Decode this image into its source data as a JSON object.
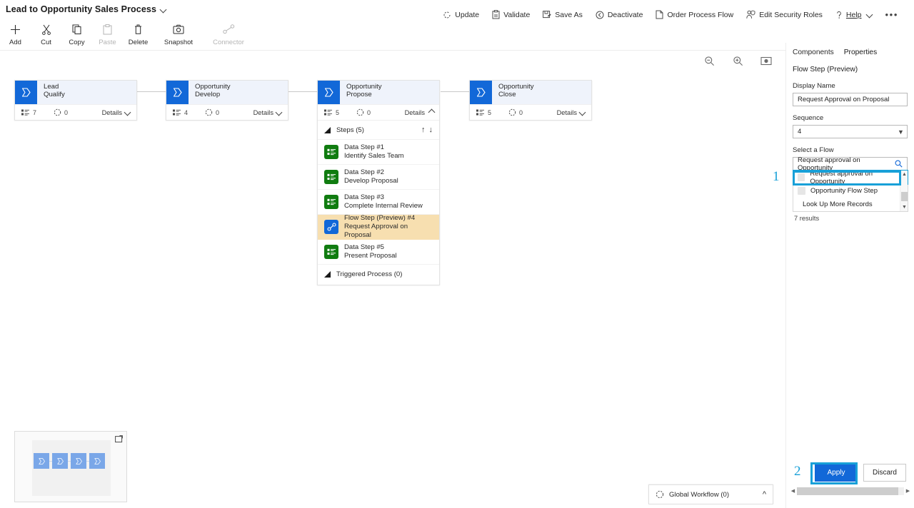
{
  "window": {
    "doc_title": "Lead to Opportunity Sales Process",
    "title_caret": "chevron-down"
  },
  "toolbar": {
    "items": [
      {
        "label": "Add",
        "icon": "plus-icon",
        "disabled": false
      },
      {
        "label": "Cut",
        "icon": "scissors-icon",
        "disabled": false
      },
      {
        "label": "Copy",
        "icon": "copy-icon",
        "disabled": false
      },
      {
        "label": "Paste",
        "icon": "paste-icon",
        "disabled": true
      },
      {
        "label": "Delete",
        "icon": "trash-icon",
        "disabled": false
      },
      {
        "label": "Snapshot",
        "icon": "camera-icon",
        "disabled": false
      },
      {
        "label": "Connector",
        "icon": "connector-icon",
        "disabled": true
      }
    ],
    "right_items": [
      {
        "label": "Update",
        "icon": "refresh-icon"
      },
      {
        "label": "Validate",
        "icon": "clipboard-check-icon"
      },
      {
        "label": "Save As",
        "icon": "save-as-icon"
      },
      {
        "label": "Deactivate",
        "icon": "deactivate-icon"
      },
      {
        "label": "Order Process Flow",
        "icon": "document-icon"
      },
      {
        "label": "Edit Security Roles",
        "icon": "people-security-icon"
      },
      {
        "label": "Help",
        "icon": "question-icon",
        "caret": true
      }
    ],
    "overflow_label": "•••"
  },
  "canvas": {
    "zoom_tools": [
      {
        "name": "zoom-out",
        "glyph": "zoom-out-icon"
      },
      {
        "name": "zoom-in",
        "glyph": "zoom-in-icon"
      },
      {
        "name": "fit-to-screen",
        "glyph": "fit-screen-icon"
      }
    ],
    "stages": [
      {
        "entity": "Lead",
        "label": "Qualify",
        "fields_count": "7",
        "process_count": "0",
        "details_label": "Details",
        "expanded": false
      },
      {
        "entity": "Opportunity",
        "label": "Develop",
        "fields_count": "4",
        "process_count": "0",
        "details_label": "Details",
        "expanded": false
      },
      {
        "entity": "Opportunity",
        "label": "Propose",
        "fields_count": "5",
        "process_count": "0",
        "details_label": "Details",
        "expanded": true
      },
      {
        "entity": "Opportunity",
        "label": "Close",
        "fields_count": "5",
        "process_count": "0",
        "details_label": "Details",
        "expanded": false
      }
    ],
    "steps_panel": {
      "header": "Steps (5)",
      "steps": [
        {
          "title": "Data Step #1",
          "subtitle": "Identify Sales Team",
          "type": "data",
          "selected": false
        },
        {
          "title": "Data Step #2",
          "subtitle": "Develop Proposal",
          "type": "data",
          "selected": false
        },
        {
          "title": "Data Step #3",
          "subtitle": "Complete Internal Review",
          "type": "data",
          "selected": false
        },
        {
          "title": "Flow Step (Preview) #4",
          "subtitle": "Request Approval on Proposal",
          "type": "flow",
          "selected": true
        },
        {
          "title": "Data Step #5",
          "subtitle": "Present Proposal",
          "type": "data",
          "selected": false
        }
      ],
      "triggered_process": "Triggered Process (0)"
    },
    "global_workflow": {
      "label": "Global Workflow (0)",
      "caret": "chevron-up"
    },
    "minimap": {
      "expand_icon": "expand-minimap-icon",
      "node_count": 4
    }
  },
  "panel": {
    "tabs": [
      {
        "label": "Components",
        "active": false
      },
      {
        "label": "Properties",
        "active": true
      }
    ],
    "heading": "Flow Step (Preview)",
    "display_name": {
      "label": "Display Name",
      "value": "Request Approval on Proposal"
    },
    "sequence": {
      "label": "Sequence",
      "value": "4"
    },
    "select_flow": {
      "label": "Select a Flow",
      "value": "Request approval on Opportunity",
      "search_icon": "search-icon",
      "options": [
        {
          "label": "Request approval on Opportunity",
          "highlighted": true,
          "has_icon": true
        },
        {
          "label": "Opportunity Flow Step",
          "highlighted": false,
          "has_icon": true
        },
        {
          "label": "Look Up More Records",
          "highlighted": false,
          "has_icon": false
        }
      ],
      "results_text": "7 results"
    },
    "footer": {
      "apply_label": "Apply",
      "discard_label": "Discard"
    }
  },
  "callouts": [
    {
      "number": "1"
    },
    {
      "number": "2"
    }
  ],
  "colors": {
    "accent_blue": "#1268d8",
    "highlight_teal": "#18a0d8",
    "step_green": "#107c10",
    "selected_step_bg": "#f7dfb0",
    "stage_header_bg": "#eff3fb"
  }
}
